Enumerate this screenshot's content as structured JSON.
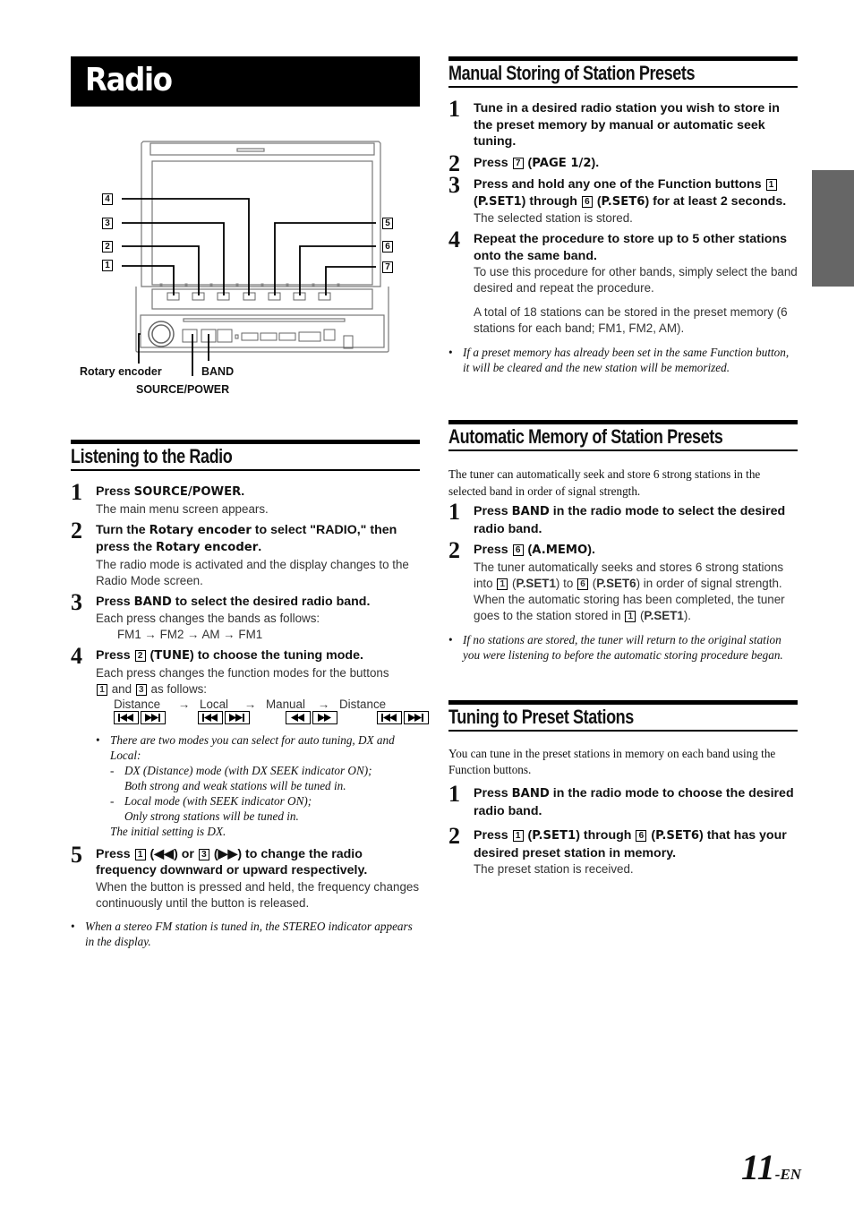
{
  "page": {
    "title": "Radio",
    "page_number": "11",
    "page_suffix": "-EN"
  },
  "diagram": {
    "callouts_left": [
      "4",
      "3",
      "2",
      "1"
    ],
    "callouts_right": [
      "5",
      "6",
      "7"
    ],
    "labels": {
      "rotary_encoder": "Rotary encoder",
      "band": "BAND",
      "source_power": "SOURCE/POWER"
    }
  },
  "listening": {
    "heading": "Listening to the Radio",
    "steps": [
      {
        "num": "1",
        "head_pre": "Press ",
        "head_key": "SOURCE/POWER",
        "head_post": ".",
        "body": "The main menu screen appears."
      },
      {
        "num": "2",
        "head_a": "Turn the ",
        "head_key1": "Rotary encoder",
        "head_b": " to select \"RADIO,\" then press the ",
        "head_key2": "Rotary encoder",
        "head_c": ".",
        "body": "The radio mode is activated and the display changes to the Radio Mode screen."
      },
      {
        "num": "3",
        "head_pre": "Press ",
        "head_key": "BAND",
        "head_post": " to select the desired radio band.",
        "body": "Each press changes the bands as follows:",
        "sequence": "FM1 → FM2 → AM → FM1"
      },
      {
        "num": "4",
        "head_pre": "Press ",
        "key": "2",
        "head_key": "TUNE",
        "head_post": ") to choose the tuning mode.",
        "body_a": "Each press changes the function modes for the buttons",
        "key_a": "1",
        "body_and": " and ",
        "key_b": "3",
        "body_b": " as follows:",
        "modes": [
          "Distance",
          "→",
          "Local",
          "→",
          "Manual",
          "→",
          "Distance"
        ],
        "notes": {
          "main": "There are two modes you can select for auto tuning, DX and Local:",
          "dx_a": "DX (Distance) mode (with DX SEEK indicator ON);",
          "dx_b": "Both strong and weak stations will be tuned in.",
          "local_a": "Local mode (with SEEK indicator ON);",
          "local_b": "Only strong stations will be tuned in.",
          "initial": "The initial setting is DX."
        }
      },
      {
        "num": "5",
        "head_pre": "Press ",
        "key1": "1",
        "head_mid1": " (◀◀) or ",
        "key2": "3",
        "head_mid2": " (▶▶) to change the radio frequency downward or upward respectively.",
        "body": "When the button is pressed and held, the frequency changes continuously until the button is released."
      }
    ],
    "note": "When a stereo FM station is tuned in, the STEREO indicator appears in the display."
  },
  "manual": {
    "heading": "Manual Storing of Station Presets",
    "step1": "Tune in a desired radio station you wish to store in the preset memory by manual or automatic seek tuning.",
    "step2": {
      "pre": "Press ",
      "key": "7",
      "label": "PAGE 1/2"
    },
    "step3": {
      "pre": "Press and hold any one of the Function buttons ",
      "key1": "1",
      "label1": "P.SET1",
      "mid": " through ",
      "key2": "6",
      "label2": "P.SET6",
      "post": " for at least 2 seconds.",
      "body": "The selected station is stored."
    },
    "step4": {
      "head": "Repeat the procedure to store up to 5 other stations onto the same band.",
      "body1": "To use this procedure for other bands, simply select the band desired and repeat the procedure.",
      "body2": "A total of 18 stations can be stored in the preset memory (6 stations for each band; FM1, FM2, AM)."
    },
    "note": "If a preset memory has already been set in the same Function button, it will be cleared and the new station will be memorized."
  },
  "automatic": {
    "heading": "Automatic Memory of Station Presets",
    "intro": "The tuner can automatically seek and store 6 strong stations in the selected band in order of signal strength.",
    "step1": {
      "pre": "Press ",
      "key": "BAND",
      "post": " in the radio mode to select the desired radio band."
    },
    "step2": {
      "pre": "Press ",
      "key": "6",
      "label": "A.MEMO",
      "body_a": "The tuner automatically seeks and stores 6 strong stations into ",
      "k1": "1",
      "l1": "P.SET1",
      "body_b": " to ",
      "k2": "6",
      "l2": "P.SET6",
      "body_c": " in order of signal strength. When the automatic storing has been completed, the tuner goes to the station stored in ",
      "k3": "1",
      "l3": "P.SET1",
      "body_d": ")."
    },
    "note": "If no stations are stored, the tuner will return to the original station you were listening to before the automatic storing procedure began."
  },
  "tuning": {
    "heading": "Tuning to Preset Stations",
    "intro": "You can tune in the preset stations in memory on each band using the Function buttons.",
    "step1": {
      "pre": "Press ",
      "key": "BAND",
      "post": " in the radio mode to choose the desired radio band."
    },
    "step2": {
      "pre": "Press ",
      "k1": "1",
      "l1": "P.SET1",
      "mid": " through ",
      "k2": "6",
      "l2": "P.SET6",
      "post": " that has your desired preset station in memory.",
      "body": "The preset station is received."
    }
  }
}
